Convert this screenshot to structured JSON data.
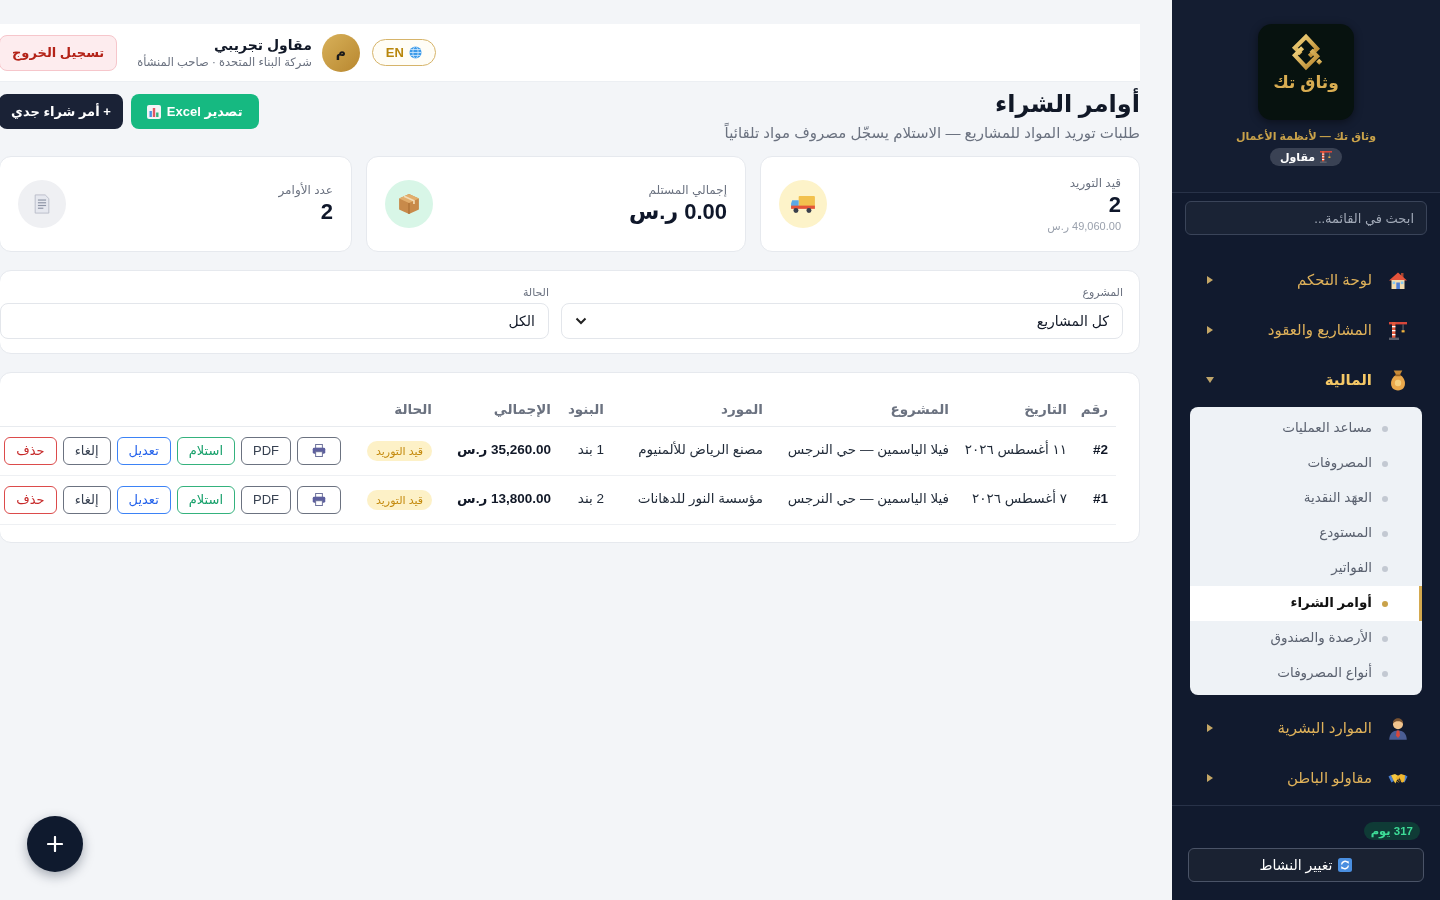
{
  "sidebar": {
    "logo_text": "وثاق تك",
    "tagline": "وثاق تك — لأنظمة الأعمال",
    "role_badge": "مقاول",
    "search": {
      "placeholder": "ابحث في القائمة..."
    },
    "items": [
      {
        "label": "لوحة التحكم",
        "expanded": false
      },
      {
        "label": "المشاريع والعقود",
        "expanded": false
      },
      {
        "label": "المالية",
        "expanded": true,
        "children": [
          {
            "label": "مساعد العمليات",
            "selected": false
          },
          {
            "label": "المصروفات",
            "selected": false
          },
          {
            "label": "العهَد النقدية",
            "selected": false
          },
          {
            "label": "المستودع",
            "selected": false
          },
          {
            "label": "الفواتير",
            "selected": false
          },
          {
            "label": "أوامر الشراء",
            "selected": true
          },
          {
            "label": "الأرصدة والصندوق",
            "selected": false
          },
          {
            "label": "أنواع المصروفات",
            "selected": false
          }
        ]
      },
      {
        "label": "الموارد البشرية",
        "expanded": false
      },
      {
        "label": "مقاولو الباطن",
        "expanded": false
      }
    ],
    "days_badge": "317 يوم",
    "switch_button": "تغيير النشاط"
  },
  "header": {
    "language": "EN",
    "avatar": "م",
    "user_name": "مقاول تجريبي",
    "user_subtitle": "شركة البناء المتحدة · صاحب المنشأة",
    "logout": "تسجيل الخروج"
  },
  "page": {
    "title": "أوامر الشراء",
    "subtitle": "طلبات توريد المواد للمشاريع — الاستلام يسجّل مصروف مواد تلقائياً",
    "actions": [
      {
        "label": "تصدير Excel",
        "kind": "export"
      },
      {
        "label": "+ أمر شراء جدي",
        "kind": "create"
      }
    ]
  },
  "stats": [
    {
      "label": "قيد التوريد",
      "value": "2",
      "note": "49,060.00 ر.س"
    },
    {
      "label": "إجمالي المستلم",
      "value": "0.00 ر.س"
    },
    {
      "label": "عدد الأوامر",
      "value": "2"
    }
  ],
  "filters": [
    {
      "label": "المشروع",
      "value": "كل المشاريع"
    },
    {
      "label": "الحالة",
      "value": "الكل"
    }
  ],
  "table": {
    "columns": [
      "رقم",
      "التاريخ",
      "المشروع",
      "المورد",
      "البنود",
      "الإجمالي",
      "الحالة"
    ],
    "rows": [
      {
        "number": "#2",
        "date": "١١ أغسطس ٢٠٢٦",
        "project": "فيلا الياسمين — حي النرجس",
        "supplier": "مصنع الرياض للألمنيوم",
        "items": "1 بند",
        "total": "35,260.00 ر.س",
        "status": "قيد التوريد",
        "actions": [
          {
            "kind": "print"
          },
          {
            "kind": "neutral",
            "label": "PDF"
          },
          {
            "kind": "success",
            "label": "استلام"
          },
          {
            "kind": "primary",
            "label": "تعديل"
          },
          {
            "kind": "neutral",
            "label": "إلغاء"
          },
          {
            "kind": "danger",
            "label": "حذف"
          }
        ]
      },
      {
        "number": "#1",
        "date": "٧ أغسطس ٢٠٢٦",
        "project": "فيلا الياسمين — حي النرجس",
        "supplier": "مؤسسة النور للدهانات",
        "items": "2 بند",
        "total": "13,800.00 ر.س",
        "status": "قيد التوريد",
        "actions": [
          {
            "kind": "print"
          },
          {
            "kind": "neutral",
            "label": "PDF"
          },
          {
            "kind": "success",
            "label": "استلام"
          },
          {
            "kind": "primary",
            "label": "تعديل"
          },
          {
            "kind": "neutral",
            "label": "إلغاء"
          },
          {
            "kind": "danger",
            "label": "حذف"
          }
        ]
      }
    ]
  }
}
